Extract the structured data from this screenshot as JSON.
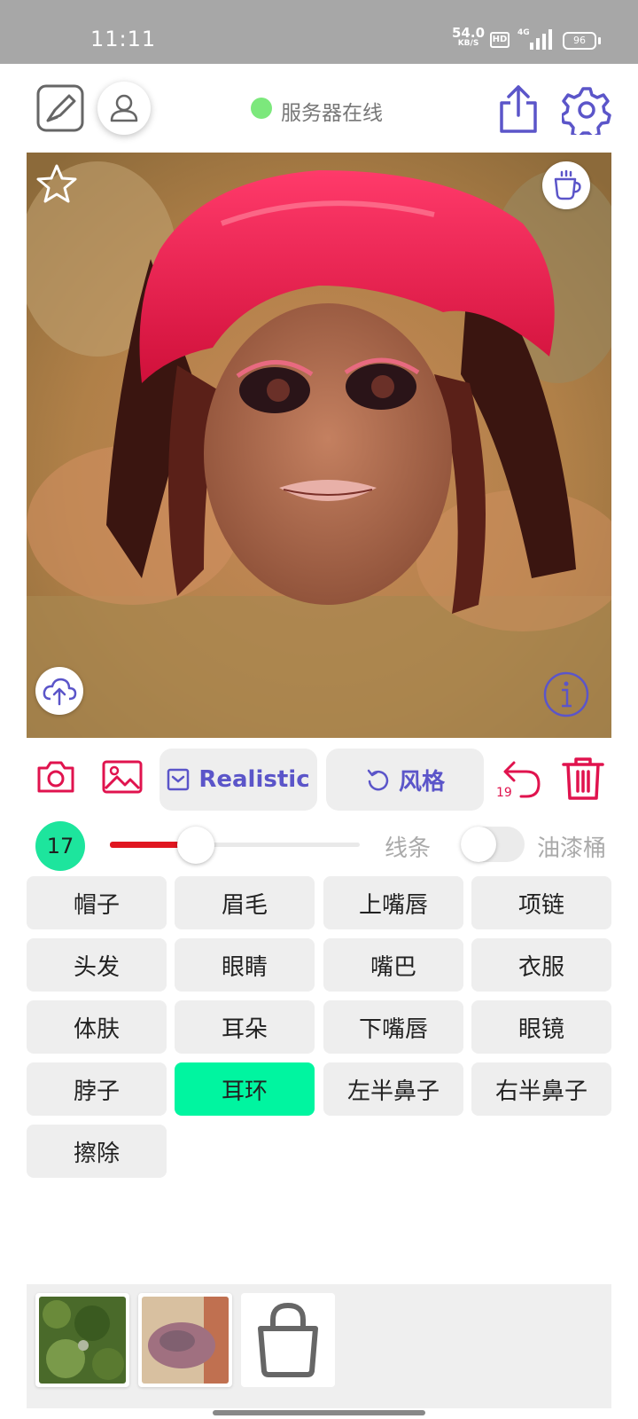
{
  "status_bar": {
    "time": "11:11",
    "net_speed": "54.0",
    "net_unit": "KB/S",
    "hd": "HD",
    "network": "4G",
    "battery": "96"
  },
  "header": {
    "server_status": "服务器在线",
    "icons": [
      "sketch-icon",
      "user-icon",
      "share-icon",
      "gear-icon"
    ]
  },
  "canvas": {
    "icons": [
      "star-icon",
      "coffee-icon",
      "upload-cloud-icon",
      "info-icon"
    ]
  },
  "toolbar": {
    "model_label": "Realistic",
    "style_label": "风格",
    "undo_count": "19"
  },
  "brush": {
    "size": "17",
    "size_fraction": 0.33,
    "lines_label": "线条",
    "bucket_label": "油漆桶",
    "bucket_enabled": false
  },
  "parts": [
    {
      "label": "帽子"
    },
    {
      "label": "眉毛"
    },
    {
      "label": "上嘴唇"
    },
    {
      "label": "项链"
    },
    {
      "label": "头发"
    },
    {
      "label": "眼睛"
    },
    {
      "label": "嘴巴"
    },
    {
      "label": "衣服"
    },
    {
      "label": "体肤"
    },
    {
      "label": "耳朵"
    },
    {
      "label": "下嘴唇"
    },
    {
      "label": "眼镜"
    },
    {
      "label": "脖子"
    },
    {
      "label": "耳环",
      "selected": true
    },
    {
      "label": "左半鼻子"
    },
    {
      "label": "右半鼻子"
    },
    {
      "label": "擦除"
    }
  ],
  "colors": {
    "accent": "#5b55c9",
    "danger": "#e0134e",
    "selected": "#00f5a0",
    "online": "#7ce87c"
  }
}
